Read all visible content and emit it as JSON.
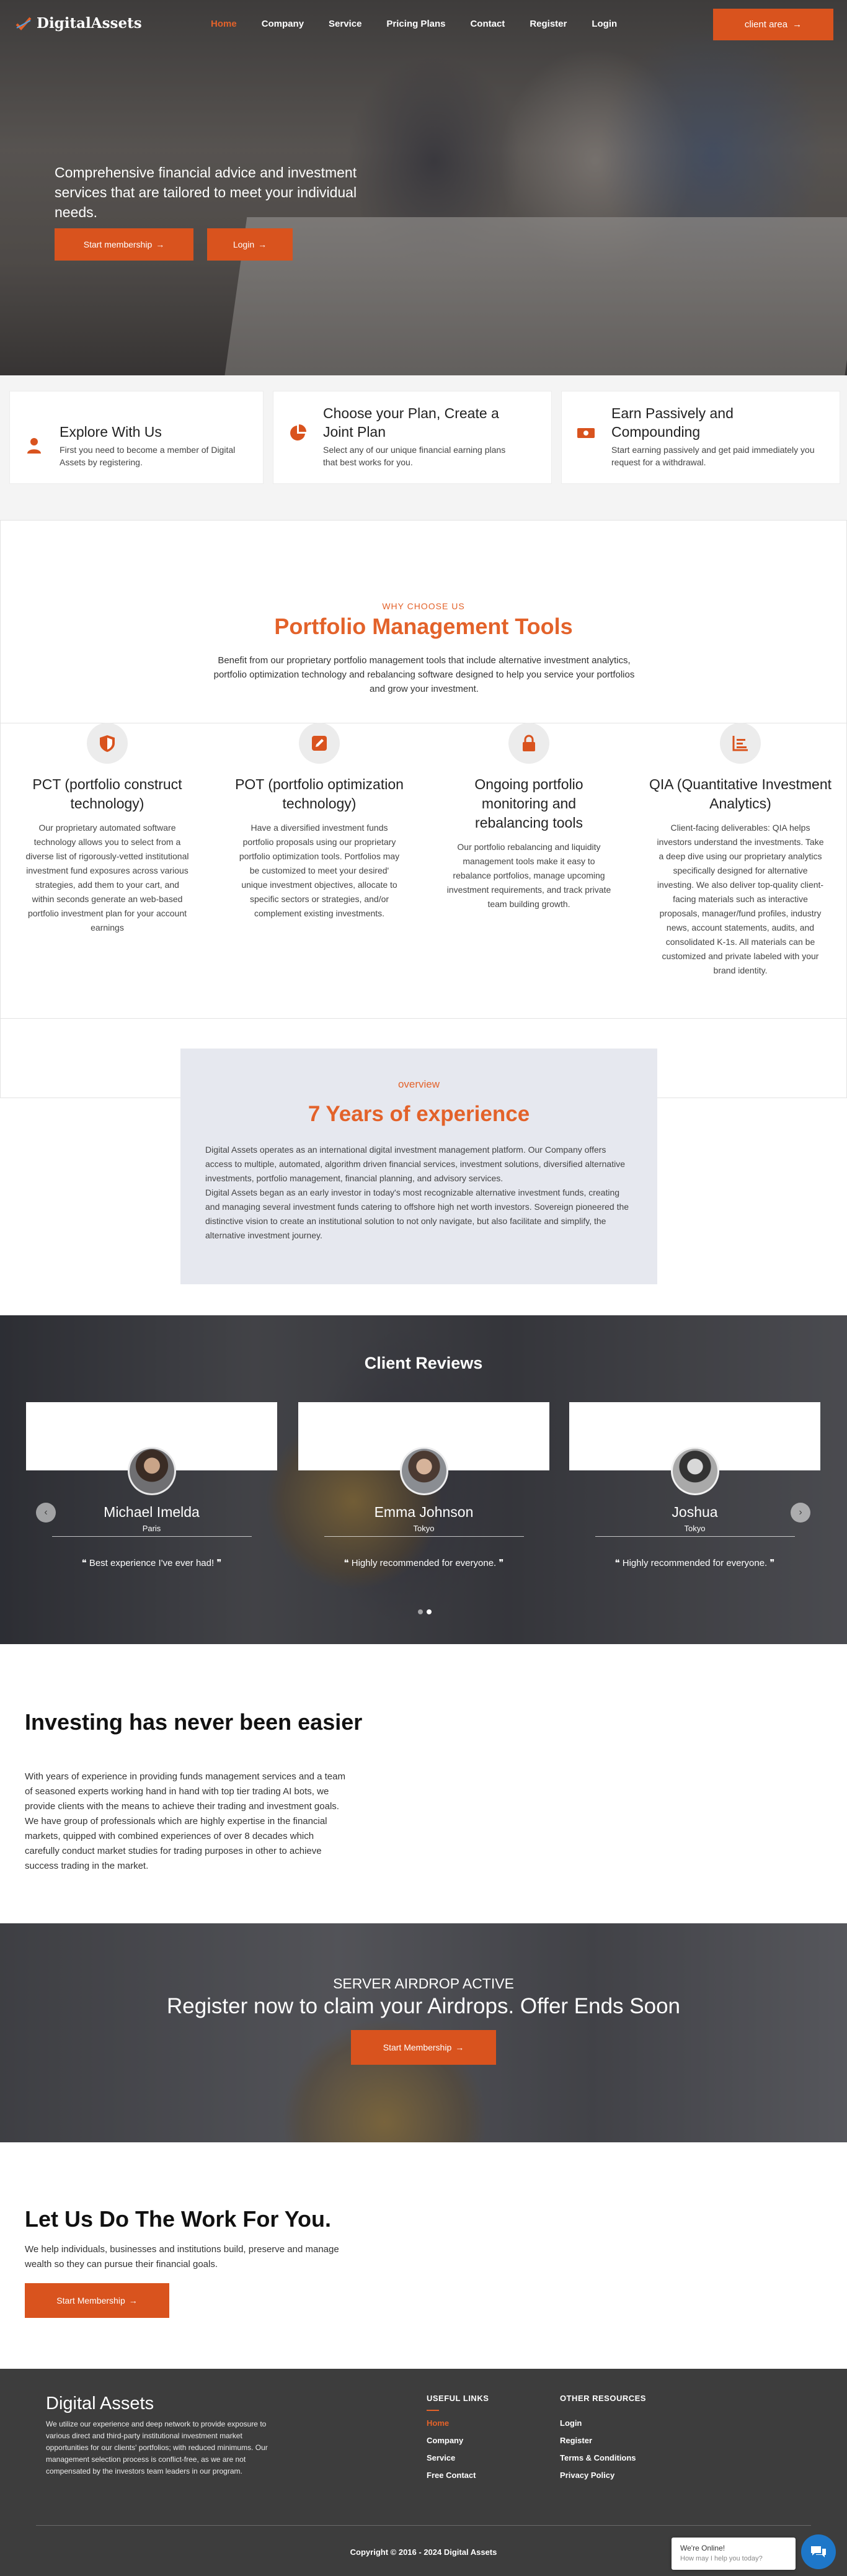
{
  "nav": {
    "brand": "DigitalAssets",
    "items": [
      "Home",
      "Company",
      "Service",
      "Pricing Plans",
      "Contact",
      "Register",
      "Login"
    ],
    "client_button": "client area"
  },
  "hero": {
    "text": "Comprehensive financial advice and investment services that are tailored to meet your individual needs.",
    "start_button": "Start membership",
    "login_button": "Login"
  },
  "steps": [
    {
      "title": "Explore With Us",
      "desc": "First you need to become a member of Digital Assets by registering.",
      "icon": "user-icon"
    },
    {
      "title": "Choose your Plan, Create a Joint Plan",
      "desc": "Select any of our unique financial earning plans that best works for you.",
      "icon": "pie-chart-icon"
    },
    {
      "title": "Earn Passively and Compounding",
      "desc": "Start earning passively and get paid immediately you request for a withdrawal.",
      "icon": "money-icon"
    }
  ],
  "portfolio": {
    "eyebrow": "WHY CHOOSE US",
    "title": "Portfolio Management Tools",
    "desc": "Benefit from our proprietary portfolio management tools that include alternative investment analytics, portfolio optimization technology and rebalancing software designed to help you service your portfolios and grow your investment.",
    "items": [
      {
        "title": "PCT (portfolio construct technology)",
        "desc": "Our proprietary automated software technology allows you to select from a diverse list of rigorously-vetted institutional investment fund exposures across various strategies, add them to your cart, and within seconds generate an web-based portfolio investment plan for your account earnings",
        "icon": "shield-icon"
      },
      {
        "title": "POT (portfolio optimization technology)",
        "desc": "Have a diversified investment funds portfolio proposals using our proprietary portfolio optimization tools. Portfolios may be customized to meet your desired' unique investment objectives, allocate to specific sectors or strategies, and/or complement existing investments.",
        "icon": "edit-icon"
      },
      {
        "title": "Ongoing portfolio monitoring and rebalancing tools",
        "desc": "Our portfolio rebalancing and liquidity management tools make it easy to rebalance portfolios, manage upcoming investment requirements, and track private team building growth.",
        "icon": "lock-icon"
      },
      {
        "title": "QIA (Quantitative Investment Analytics)",
        "desc": "Client-facing deliverables: QIA helps investors understand the investments. Take a deep dive using our proprietary analytics specifically designed for alternative investing. We also deliver top-quality client-facing materials such as interactive proposals, manager/fund profiles, industry news, account statements, audits, and consolidated K-1s. All materials can be customized and private labeled with your brand identity.",
        "icon": "bar-chart-icon"
      }
    ]
  },
  "overview": {
    "eyebrow": "overview",
    "title": "7 Years of experience",
    "p1": "Digital Assets operates as an international digital investment management platform. Our Company offers access to multiple, automated, algorithm driven financial services, investment solutions, diversified alternative investments, portfolio management, financial planning, and advisory services.",
    "p2": "Digital Assets began as an early investor in today's most recognizable alternative investment funds, creating and managing several investment funds catering to offshore high net worth investors. Sovereign pioneered the distinctive vision to create an institutional solution to not only navigate, but also facilitate and simplify, the alternative investment journey."
  },
  "reviews": {
    "title": "Client Reviews",
    "items": [
      {
        "name": "Michael Imelda",
        "city": "Paris",
        "quote": "Best experience I've ever had!"
      },
      {
        "name": "Emma Johnson",
        "city": "Tokyo",
        "quote": "Highly recommended for everyone."
      },
      {
        "name": "Joshua",
        "city": "Tokyo",
        "quote": "Highly recommended for everyone."
      }
    ]
  },
  "investing": {
    "title": "Investing has never been easier",
    "desc": "With years of experience in providing funds management services and a team of seasoned experts working hand in hand with top tier trading AI bots, we provide clients with the means to achieve their trading and investment goals. We have group of professionals which are highly expertise in the financial markets, quipped with combined experiences of over 8 decades which carefully conduct market studies for trading purposes in other to achieve success trading in the market."
  },
  "airdrop": {
    "small": "SERVER AIRDROP ACTIVE",
    "big": "Register now to claim your Airdrops. Offer Ends Soon",
    "button": "Start Membership"
  },
  "work": {
    "title": "Let Us Do The Work For You.",
    "desc": "We help individuals, businesses and institutions build, preserve and manage wealth so they can pursue their financial goals.",
    "button": "Start Membership"
  },
  "footer": {
    "brand": "Digital Assets",
    "about": "We utilize our experience and deep network to provide exposure to various direct and third-party institutional investment market opportunities for our clients' portfolios; with reduced minimums. Our management selection process is conflict-free, as we are not compensated by the investors team leaders in our program.",
    "useful_head": "USEFUL LINKS",
    "useful_links": [
      "Home",
      "Company",
      "Service",
      "Free Contact"
    ],
    "other_head": "OTHER RESOURCES",
    "other_links": [
      "Login",
      "Register",
      "Terms & Conditions",
      "Privacy Policy"
    ],
    "copyright": "Copyright © 2016 - 2024 Digital Assets"
  },
  "chat": {
    "status": "We're Online!",
    "sub": "How may I help you today?"
  },
  "colors": {
    "accent": "#d9531e",
    "accent_text": "#e3622a",
    "footer_bg": "#3d3d3d",
    "overview_bg": "#e6e8ef"
  }
}
